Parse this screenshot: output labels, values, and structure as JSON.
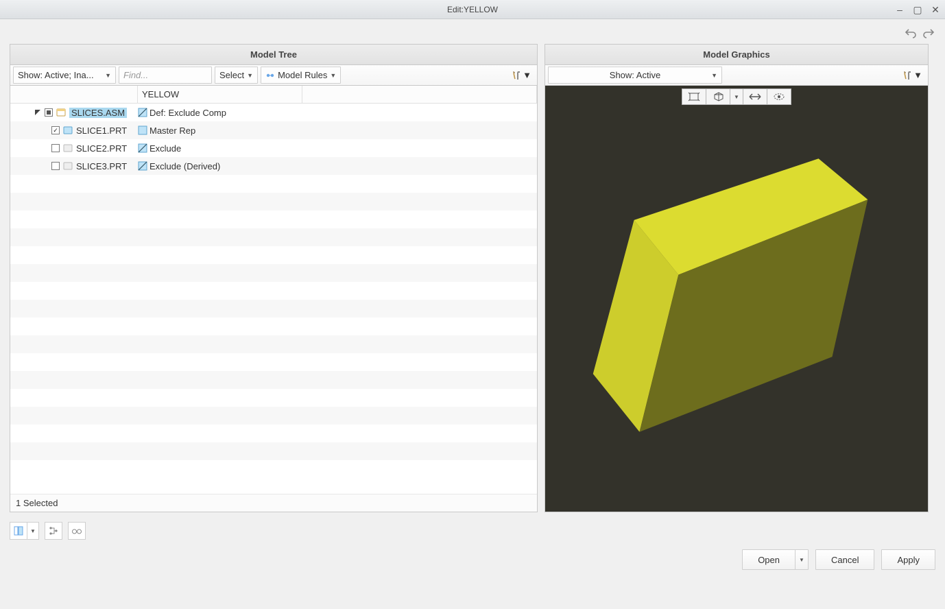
{
  "window": {
    "title": "Edit:YELLOW"
  },
  "left_panel": {
    "title": "Model Tree",
    "show_label": "Show: Active; Ina...",
    "find_placeholder": "Find...",
    "select_label": "Select",
    "model_rules_label": "Model Rules",
    "column_header": "YELLOW",
    "rows": [
      {
        "name": "SLICES.ASM",
        "member": "Def: Exclude Comp"
      },
      {
        "name": "SLICE1.PRT",
        "member": "Master Rep"
      },
      {
        "name": "SLICE2.PRT",
        "member": "Exclude"
      },
      {
        "name": "SLICE3.PRT",
        "member": "Exclude (Derived)"
      }
    ],
    "status": "1 Selected"
  },
  "right_panel": {
    "title": "Model Graphics",
    "show_label": "Show: Active"
  },
  "footer": {
    "open": "Open",
    "cancel": "Cancel",
    "apply": "Apply"
  }
}
